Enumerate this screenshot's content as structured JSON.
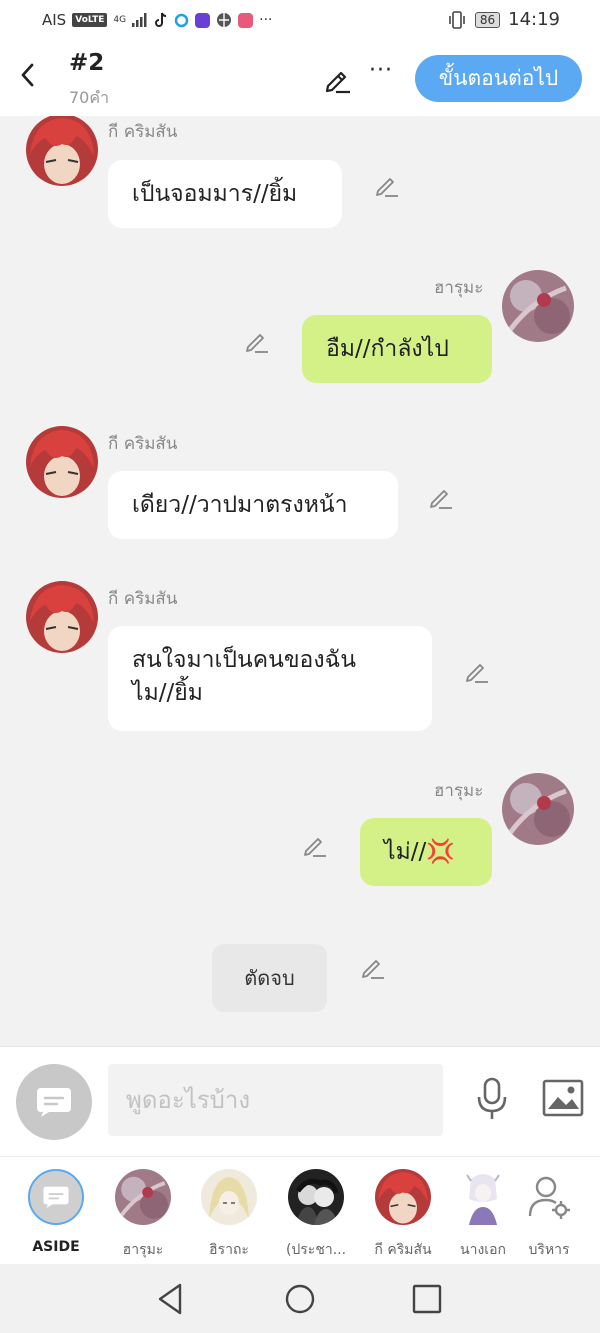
{
  "status_bar": {
    "carrier": "AIS",
    "volte": "VoLTE",
    "network": "4G",
    "battery": "86",
    "time": "14:19"
  },
  "header": {
    "title": "#2",
    "word_count": "70คำ",
    "next_button": "ขั้นตอนต่อไป",
    "more": "···"
  },
  "messages": [
    {
      "side": "left",
      "sender": "กี คริมสัน",
      "text": "เป็นจอมมาร//ยิ้ม"
    },
    {
      "side": "right",
      "sender": "ฮารุมะ",
      "text": "อืม//กำลังไป"
    },
    {
      "side": "left",
      "sender": "กี คริมสัน",
      "text": "เดียว//วาปมาตรงหน้า"
    },
    {
      "side": "left",
      "sender": "กี คริมสัน",
      "text_line1": "สนใจมาเป็นคนของฉัน",
      "text_line2": "ไม//ยิ้ม"
    },
    {
      "side": "right",
      "sender": "ฮารุมะ",
      "text": "ไม่//💢"
    }
  ],
  "end_chip": "ตัดจบ",
  "input": {
    "placeholder": "พูดอะไรบ้าง",
    "value": ""
  },
  "characters": [
    {
      "label": "ASIDE",
      "active": true
    },
    {
      "label": "ฮารุมะ"
    },
    {
      "label": "ฮิราถะ"
    },
    {
      "label": "(ประชา..."
    },
    {
      "label": "กี คริมสัน"
    },
    {
      "label": "นางเอก"
    },
    {
      "label": "บริหาร"
    }
  ],
  "colors": {
    "accent": "#5aa9f2",
    "outgoing_bubble": "#d3f187",
    "incoming_bubble": "#ffffff",
    "background": "#f2f2f2"
  }
}
